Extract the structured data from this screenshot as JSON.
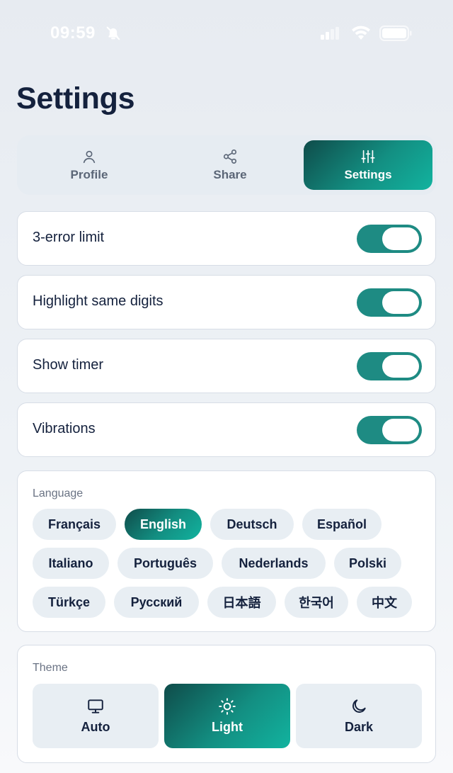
{
  "status_bar": {
    "time": "09:59"
  },
  "page": {
    "title": "Settings"
  },
  "tabs": [
    {
      "label": "Profile",
      "icon": "user-icon",
      "active": false
    },
    {
      "label": "Share",
      "icon": "share-icon",
      "active": false
    },
    {
      "label": "Settings",
      "icon": "sliders-icon",
      "active": true
    }
  ],
  "toggles": [
    {
      "label": "3-error limit",
      "on": true
    },
    {
      "label": "Highlight same digits",
      "on": true
    },
    {
      "label": "Show timer",
      "on": true
    },
    {
      "label": "Vibrations",
      "on": true
    }
  ],
  "language": {
    "label": "Language",
    "selected": "English",
    "options": [
      "Français",
      "English",
      "Deutsch",
      "Español",
      "Italiano",
      "Português",
      "Nederlands",
      "Polski",
      "Türkçe",
      "Русский",
      "日本語",
      "한국어",
      "中文"
    ]
  },
  "theme": {
    "label": "Theme",
    "selected": "Light",
    "options": [
      {
        "label": "Auto",
        "icon": "monitor-icon"
      },
      {
        "label": "Light",
        "icon": "sun-icon"
      },
      {
        "label": "Dark",
        "icon": "moon-icon"
      }
    ]
  },
  "colors": {
    "accent": "#1e8b83",
    "accent_dark": "#0f4c4a",
    "accent_light": "#12b39f",
    "chip_bg": "#e8eef3",
    "title": "#14213d"
  }
}
